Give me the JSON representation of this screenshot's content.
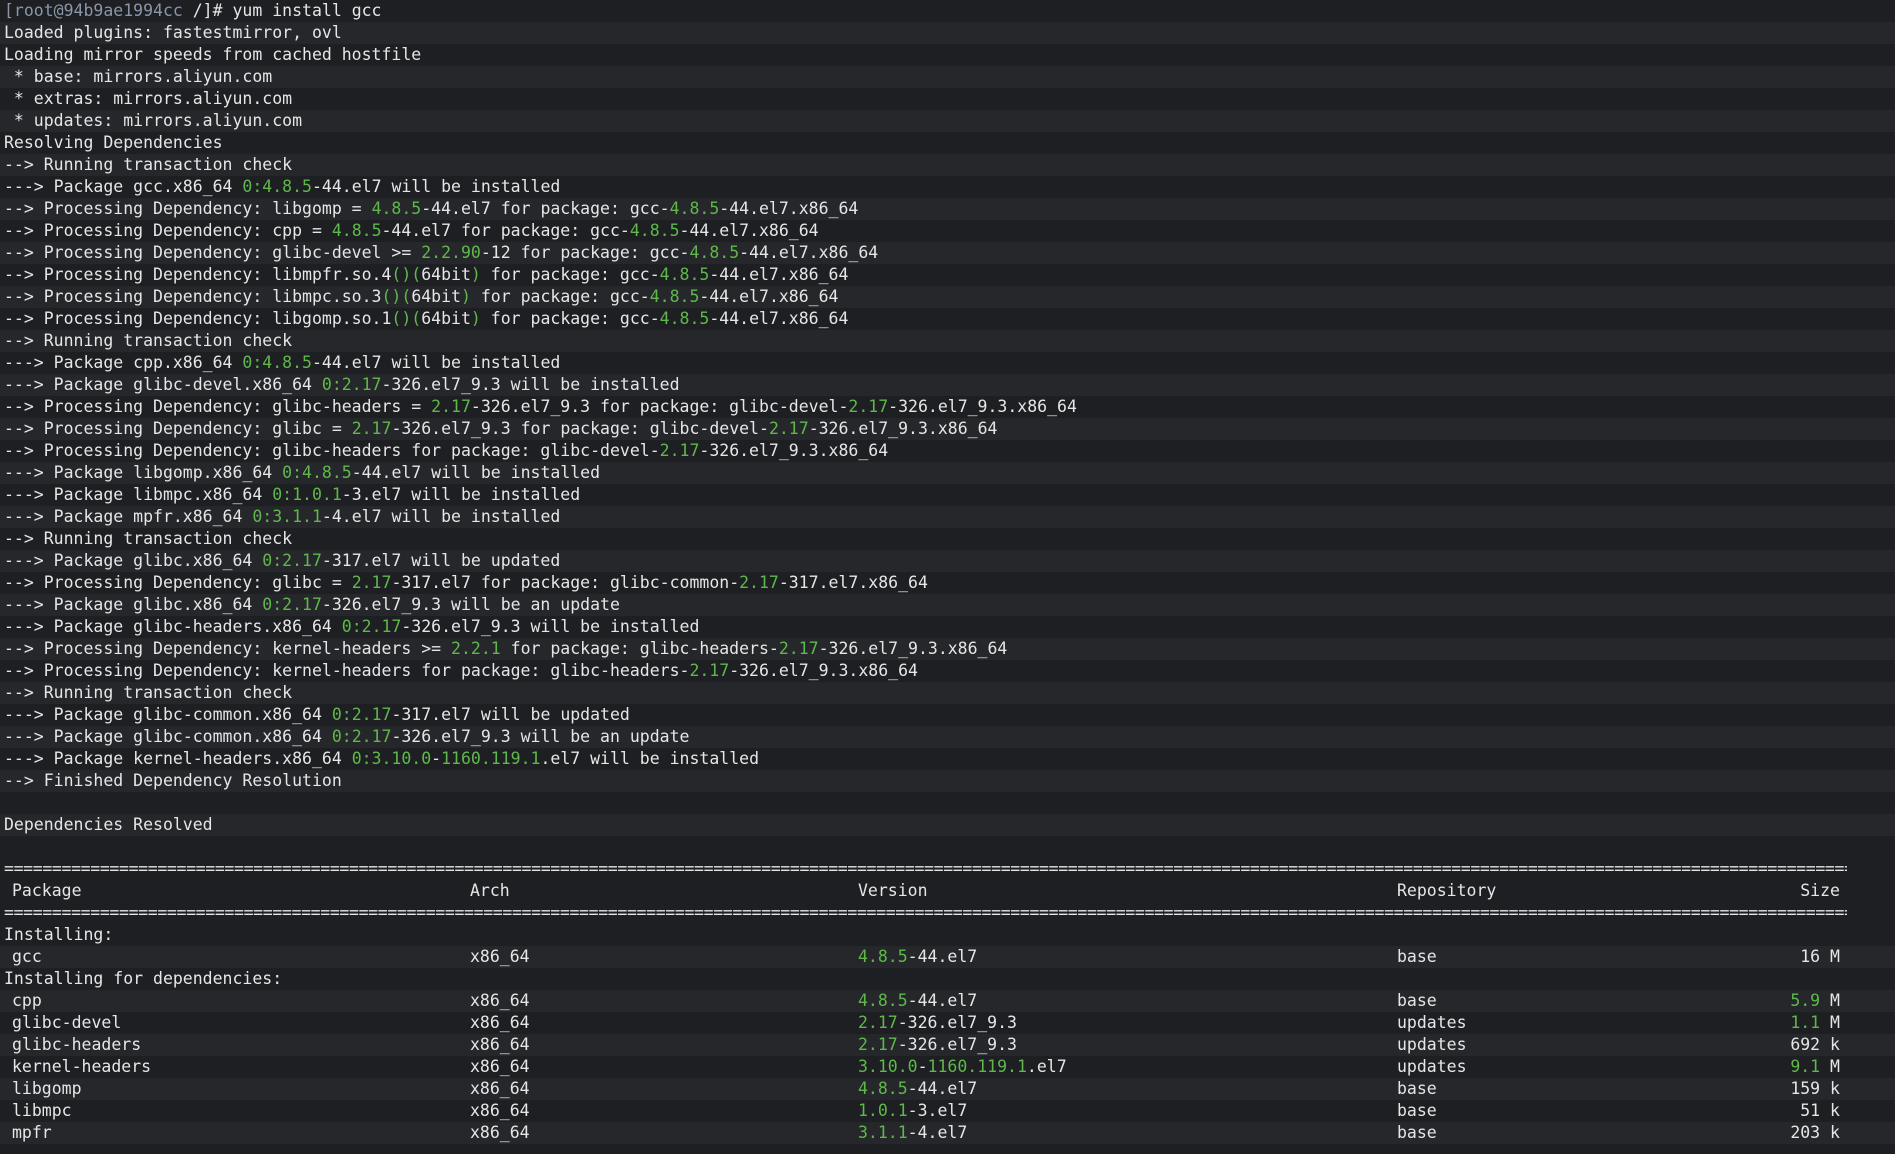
{
  "colors": {
    "background": "#1e1f22",
    "text": "#e6e6e6",
    "number": "#5fb84c",
    "prompt": "#8a96a6"
  },
  "log": [
    [
      [
        "p",
        "[root@94b9ae1994cc"
      ],
      [
        "n",
        " /]# yum install gcc"
      ]
    ],
    [
      [
        "n",
        "Loaded plugins: fastestmirror, ovl"
      ]
    ],
    [
      [
        "n",
        "Loading mirror speeds from cached hostfile"
      ]
    ],
    [
      [
        "n",
        " * base: mirrors.aliyun.com"
      ]
    ],
    [
      [
        "n",
        " * extras: mirrors.aliyun.com"
      ]
    ],
    [
      [
        "n",
        " * updates: mirrors.aliyun.com"
      ]
    ],
    [
      [
        "n",
        "Resolving Dependencies"
      ]
    ],
    [
      [
        "n",
        "--> Running transaction check"
      ]
    ],
    [
      [
        "n",
        "---> Package gcc.x86_64 "
      ],
      [
        "g",
        "0:4.8.5"
      ],
      [
        "n",
        "-44.el7 will be installed"
      ]
    ],
    [
      [
        "n",
        "--> Processing Dependency: libgomp = "
      ],
      [
        "g",
        "4.8.5"
      ],
      [
        "n",
        "-44.el7 for package: gcc-"
      ],
      [
        "g",
        "4.8.5"
      ],
      [
        "n",
        "-44.el7.x86_64"
      ]
    ],
    [
      [
        "n",
        "--> Processing Dependency: cpp = "
      ],
      [
        "g",
        "4.8.5"
      ],
      [
        "n",
        "-44.el7 for package: gcc-"
      ],
      [
        "g",
        "4.8.5"
      ],
      [
        "n",
        "-44.el7.x86_64"
      ]
    ],
    [
      [
        "n",
        "--> Processing Dependency: glibc-devel >= "
      ],
      [
        "g",
        "2.2.90"
      ],
      [
        "n",
        "-12 for package: gcc-"
      ],
      [
        "g",
        "4.8.5"
      ],
      [
        "n",
        "-44.el7.x86_64"
      ]
    ],
    [
      [
        "n",
        "--> Processing Dependency: libmpfr.so.4"
      ],
      [
        "g",
        "()("
      ],
      [
        "n",
        "64bit"
      ],
      [
        "g",
        ")"
      ],
      [
        "n",
        " for package: gcc-"
      ],
      [
        "g",
        "4.8.5"
      ],
      [
        "n",
        "-44.el7.x86_64"
      ]
    ],
    [
      [
        "n",
        "--> Processing Dependency: libmpc.so.3"
      ],
      [
        "g",
        "()("
      ],
      [
        "n",
        "64bit"
      ],
      [
        "g",
        ")"
      ],
      [
        "n",
        " for package: gcc-"
      ],
      [
        "g",
        "4.8.5"
      ],
      [
        "n",
        "-44.el7.x86_64"
      ]
    ],
    [
      [
        "n",
        "--> Processing Dependency: libgomp.so.1"
      ],
      [
        "g",
        "()("
      ],
      [
        "n",
        "64bit"
      ],
      [
        "g",
        ")"
      ],
      [
        "n",
        " for package: gcc-"
      ],
      [
        "g",
        "4.8.5"
      ],
      [
        "n",
        "-44.el7.x86_64"
      ]
    ],
    [
      [
        "n",
        "--> Running transaction check"
      ]
    ],
    [
      [
        "n",
        "---> Package cpp.x86_64 "
      ],
      [
        "g",
        "0:4.8.5"
      ],
      [
        "n",
        "-44.el7 will be installed"
      ]
    ],
    [
      [
        "n",
        "---> Package glibc-devel.x86_64 "
      ],
      [
        "g",
        "0:2.17"
      ],
      [
        "n",
        "-326.el7_9.3 will be installed"
      ]
    ],
    [
      [
        "n",
        "--> Processing Dependency: glibc-headers = "
      ],
      [
        "g",
        "2.17"
      ],
      [
        "n",
        "-326.el7_9.3 for package: glibc-devel-"
      ],
      [
        "g",
        "2.17"
      ],
      [
        "n",
        "-326.el7_9.3.x86_64"
      ]
    ],
    [
      [
        "n",
        "--> Processing Dependency: glibc = "
      ],
      [
        "g",
        "2.17"
      ],
      [
        "n",
        "-326.el7_9.3 for package: glibc-devel-"
      ],
      [
        "g",
        "2.17"
      ],
      [
        "n",
        "-326.el7_9.3.x86_64"
      ]
    ],
    [
      [
        "n",
        "--> Processing Dependency: glibc-headers for package: glibc-devel-"
      ],
      [
        "g",
        "2.17"
      ],
      [
        "n",
        "-326.el7_9.3.x86_64"
      ]
    ],
    [
      [
        "n",
        "---> Package libgomp.x86_64 "
      ],
      [
        "g",
        "0:4.8.5"
      ],
      [
        "n",
        "-44.el7 will be installed"
      ]
    ],
    [
      [
        "n",
        "---> Package libmpc.x86_64 "
      ],
      [
        "g",
        "0:1.0.1"
      ],
      [
        "n",
        "-3.el7 will be installed"
      ]
    ],
    [
      [
        "n",
        "---> Package mpfr.x86_64 "
      ],
      [
        "g",
        "0:3.1.1"
      ],
      [
        "n",
        "-4.el7 will be installed"
      ]
    ],
    [
      [
        "n",
        "--> Running transaction check"
      ]
    ],
    [
      [
        "n",
        "---> Package glibc.x86_64 "
      ],
      [
        "g",
        "0:2.17"
      ],
      [
        "n",
        "-317.el7 will be updated"
      ]
    ],
    [
      [
        "n",
        "--> Processing Dependency: glibc = "
      ],
      [
        "g",
        "2.17"
      ],
      [
        "n",
        "-317.el7 for package: glibc-common-"
      ],
      [
        "g",
        "2.17"
      ],
      [
        "n",
        "-317.el7.x86_64"
      ]
    ],
    [
      [
        "n",
        "---> Package glibc.x86_64 "
      ],
      [
        "g",
        "0:2.17"
      ],
      [
        "n",
        "-326.el7_9.3 will be an update"
      ]
    ],
    [
      [
        "n",
        "---> Package glibc-headers.x86_64 "
      ],
      [
        "g",
        "0:2.17"
      ],
      [
        "n",
        "-326.el7_9.3 will be installed"
      ]
    ],
    [
      [
        "n",
        "--> Processing Dependency: kernel-headers >= "
      ],
      [
        "g",
        "2.2.1"
      ],
      [
        "n",
        " for package: glibc-headers-"
      ],
      [
        "g",
        "2.17"
      ],
      [
        "n",
        "-326.el7_9.3.x86_64"
      ]
    ],
    [
      [
        "n",
        "--> Processing Dependency: kernel-headers for package: glibc-headers-"
      ],
      [
        "g",
        "2.17"
      ],
      [
        "n",
        "-326.el7_9.3.x86_64"
      ]
    ],
    [
      [
        "n",
        "--> Running transaction check"
      ]
    ],
    [
      [
        "n",
        "---> Package glibc-common.x86_64 "
      ],
      [
        "g",
        "0:2.17"
      ],
      [
        "n",
        "-317.el7 will be updated"
      ]
    ],
    [
      [
        "n",
        "---> Package glibc-common.x86_64 "
      ],
      [
        "g",
        "0:2.17"
      ],
      [
        "n",
        "-326.el7_9.3 will be an update"
      ]
    ],
    [
      [
        "n",
        "---> Package kernel-headers.x86_64 "
      ],
      [
        "g",
        "0:3.10.0"
      ],
      [
        "n",
        "-"
      ],
      [
        "g",
        "1160.119.1"
      ],
      [
        "n",
        ".el7 will be installed"
      ]
    ],
    [
      [
        "n",
        "--> Finished Dependency Resolution"
      ]
    ],
    [
      [
        "n",
        ""
      ]
    ],
    [
      [
        "n",
        "Dependencies Resolved"
      ]
    ],
    [
      [
        "n",
        ""
      ]
    ]
  ],
  "separator": "======================================================================================================================================================================================================================================================",
  "table": {
    "headers": {
      "package": "Package",
      "arch": "Arch",
      "version": "Version",
      "repository": "Repository",
      "size": "Size"
    },
    "sections": [
      {
        "title": "Installing:",
        "rows": [
          {
            "package": "gcc",
            "arch": "x86_64",
            "version": [
              [
                "g",
                "4.8.5"
              ],
              [
                "n",
                "-44.el7"
              ]
            ],
            "repository": "base",
            "size_num": "16",
            "size_num_green": false,
            "size_unit": "M"
          }
        ]
      },
      {
        "title": "Installing for dependencies:",
        "rows": [
          {
            "package": "cpp",
            "arch": "x86_64",
            "version": [
              [
                "g",
                "4.8.5"
              ],
              [
                "n",
                "-44.el7"
              ]
            ],
            "repository": "base",
            "size_num": "5.9",
            "size_num_green": true,
            "size_unit": "M"
          },
          {
            "package": "glibc-devel",
            "arch": "x86_64",
            "version": [
              [
                "g",
                "2.17"
              ],
              [
                "n",
                "-326.el7_9.3"
              ]
            ],
            "repository": "updates",
            "size_num": "1.1",
            "size_num_green": true,
            "size_unit": "M"
          },
          {
            "package": "glibc-headers",
            "arch": "x86_64",
            "version": [
              [
                "g",
                "2.17"
              ],
              [
                "n",
                "-326.el7_9.3"
              ]
            ],
            "repository": "updates",
            "size_num": "692",
            "size_num_green": false,
            "size_unit": "k"
          },
          {
            "package": "kernel-headers",
            "arch": "x86_64",
            "version": [
              [
                "g",
                "3.10.0"
              ],
              [
                "n",
                "-"
              ],
              [
                "g",
                "1160.119.1"
              ],
              [
                "n",
                ".el7"
              ]
            ],
            "repository": "updates",
            "size_num": "9.1",
            "size_num_green": true,
            "size_unit": "M"
          },
          {
            "package": "libgomp",
            "arch": "x86_64",
            "version": [
              [
                "g",
                "4.8.5"
              ],
              [
                "n",
                "-44.el7"
              ]
            ],
            "repository": "base",
            "size_num": "159",
            "size_num_green": false,
            "size_unit": "k"
          },
          {
            "package": "libmpc",
            "arch": "x86_64",
            "version": [
              [
                "g",
                "1.0.1"
              ],
              [
                "n",
                "-3.el7"
              ]
            ],
            "repository": "base",
            "size_num": "51",
            "size_num_green": false,
            "size_unit": "k"
          },
          {
            "package": "mpfr",
            "arch": "x86_64",
            "version": [
              [
                "g",
                "3.1.1"
              ],
              [
                "n",
                "-4.el7"
              ]
            ],
            "repository": "base",
            "size_num": "203",
            "size_num_green": false,
            "size_unit": "k"
          }
        ]
      }
    ]
  }
}
